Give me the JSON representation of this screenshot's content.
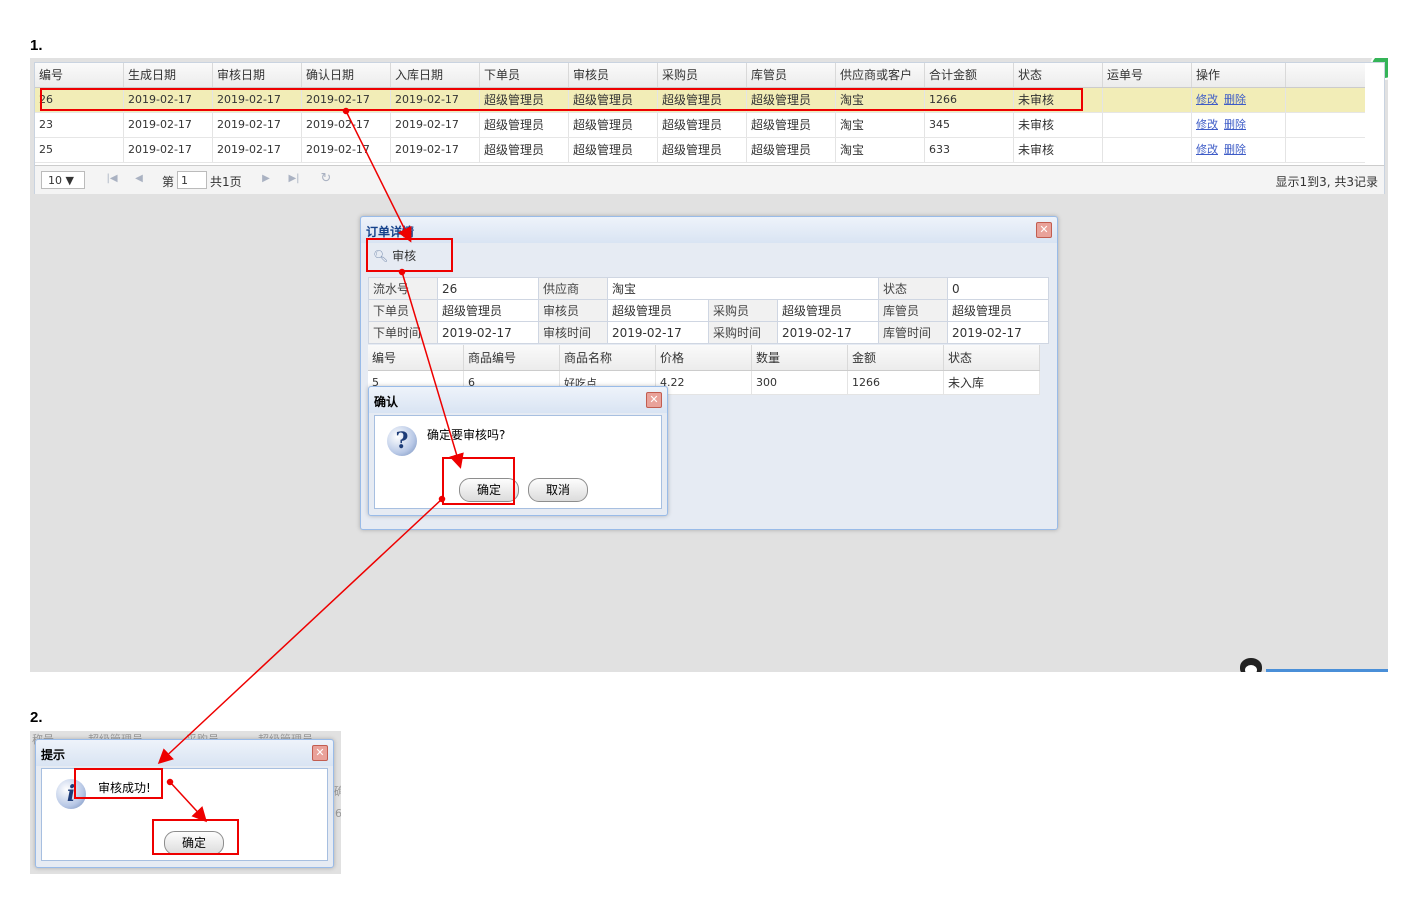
{
  "steps": {
    "step1": "1.",
    "step2": "2."
  },
  "grid": {
    "headers": [
      "编号",
      "生成日期",
      "审核日期",
      "确认日期",
      "入库日期",
      "下单员",
      "审核员",
      "采购员",
      "库管员",
      "供应商或客户",
      "合计金额",
      "状态",
      "运单号",
      "操作"
    ],
    "rows": [
      [
        "26",
        "2019-02-17",
        "2019-02-17",
        "2019-02-17",
        "2019-02-17",
        "超级管理员",
        "超级管理员",
        "超级管理员",
        "超级管理员",
        "淘宝",
        "1266",
        "未审核",
        ""
      ],
      [
        "23",
        "2019-02-17",
        "2019-02-17",
        "2019-02-17",
        "2019-02-17",
        "超级管理员",
        "超级管理员",
        "超级管理员",
        "超级管理员",
        "淘宝",
        "345",
        "未审核",
        ""
      ],
      [
        "25",
        "2019-02-17",
        "2019-02-17",
        "2019-02-17",
        "2019-02-17",
        "超级管理员",
        "超级管理员",
        "超级管理员",
        "超级管理员",
        "淘宝",
        "633",
        "未审核",
        ""
      ]
    ],
    "edit_label": "修改",
    "delete_label": "删除",
    "pager": {
      "page_size": "10 ▼",
      "page_prefix": "第",
      "page_value": "1",
      "page_suffix": "共1页",
      "summary": "显示1到3, 共3记录"
    }
  },
  "detail": {
    "title": "订单详情",
    "toolbar_audit": "审核",
    "info": {
      "flow_no_label": "流水号",
      "flow_no": "26",
      "supplier_label": "供应商",
      "supplier": "淘宝",
      "status_label": "状态",
      "status": "0",
      "orderer_label": "下单员",
      "orderer": "超级管理员",
      "checker_label": "审核员",
      "checker": "超级管理员",
      "buyer_label": "采购员",
      "buyer": "超级管理员",
      "keeper_label": "库管员",
      "keeper": "超级管理员",
      "order_time_label": "下单时间",
      "order_time": "2019-02-17",
      "check_time_label": "审核时间",
      "check_time": "2019-02-17",
      "buy_time_label": "采购时间",
      "buy_time": "2019-02-17",
      "keep_time_label": "库管时间",
      "keep_time": "2019-02-17"
    },
    "items_headers": [
      "编号",
      "商品编号",
      "商品名称",
      "价格",
      "数量",
      "金额",
      "状态"
    ],
    "items_row": [
      "5",
      "6",
      "好吃点",
      "4.22",
      "300",
      "1266",
      "未入库"
    ]
  },
  "confirm": {
    "title": "确认",
    "message": "确定要审核吗?",
    "ok": "确定",
    "cancel": "取消"
  },
  "tip": {
    "title": "提示",
    "message": "审核成功!",
    "ok": "确定"
  },
  "panel2_bg": {
    "c1": "称号",
    "c2": "超级管理员",
    "c3": "采购员",
    "c4": "超级管理员",
    "c5": "确",
    "c6": "6"
  },
  "colors": {
    "annotation": "#e00000",
    "selected_row": "#f2edb7",
    "link": "#3e5cc7"
  }
}
